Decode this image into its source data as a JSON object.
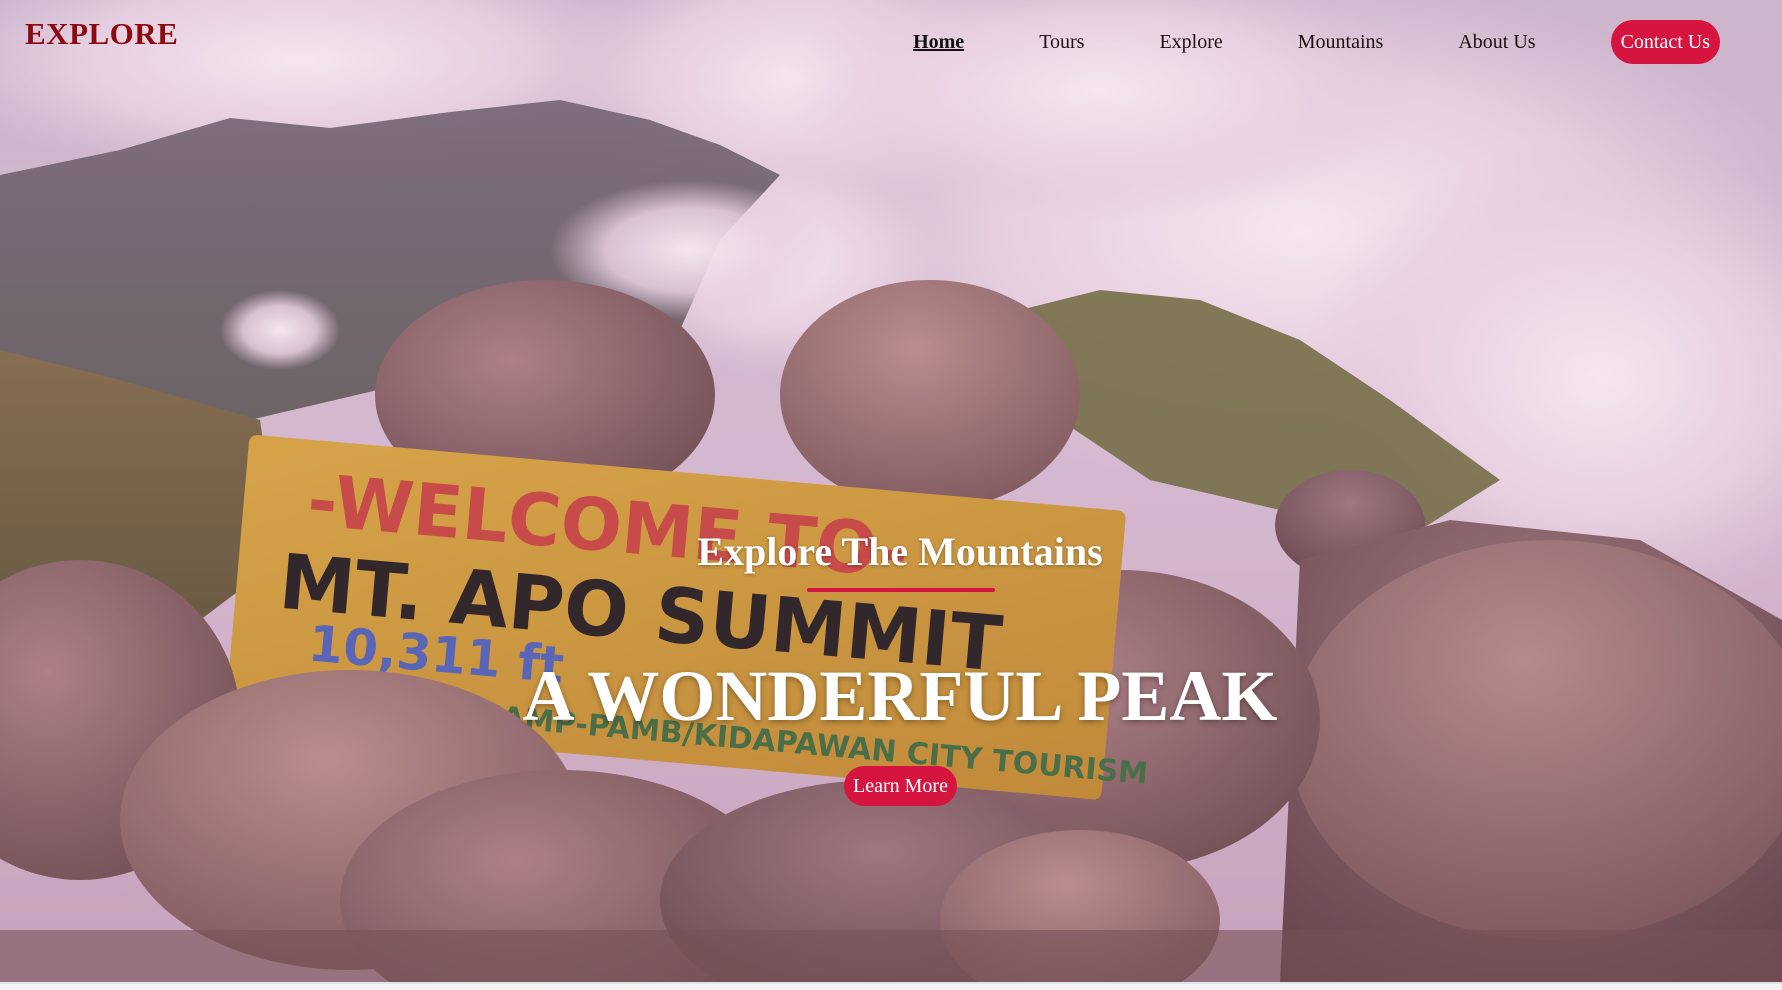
{
  "brand": {
    "logo_text": "EXPLORE"
  },
  "nav": {
    "items": [
      {
        "label": "Home",
        "active": true
      },
      {
        "label": "Tours"
      },
      {
        "label": "Explore"
      },
      {
        "label": "Mountains"
      },
      {
        "label": "About Us"
      }
    ],
    "contact_label": "Contact Us"
  },
  "hero": {
    "subtitle": "Explore The Mountains",
    "title": "A WONDERFUL PEAK",
    "cta_label": "Learn More",
    "sign": {
      "line1": "-WELCOME TO-",
      "line2": "MT. APO SUMMIT",
      "line3": "10,311 ft",
      "line4": "DENR/NAMP-PAMB/KIDAPAWAN CITY TOURISM"
    }
  },
  "colors": {
    "accent": "#d5153f",
    "logo": "#8b0a10",
    "hero_text": "#ffffff"
  }
}
